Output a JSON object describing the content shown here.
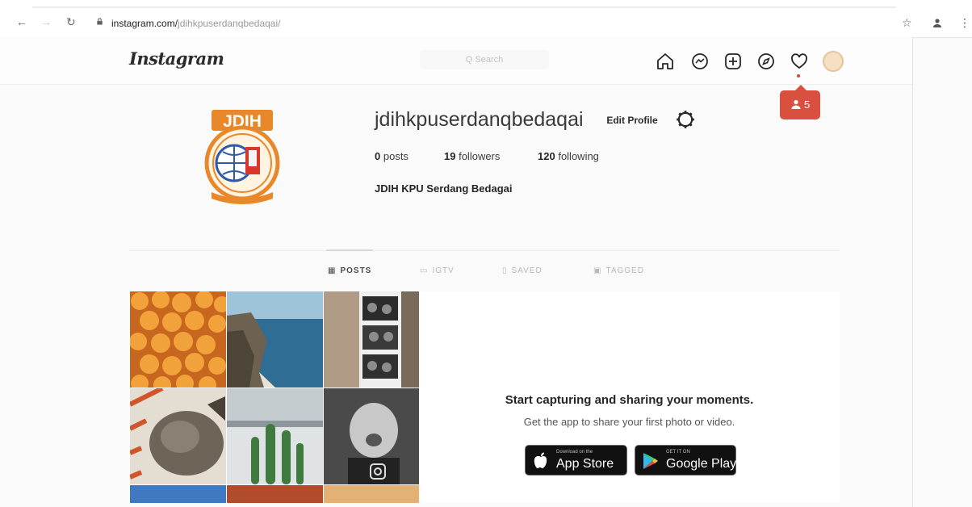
{
  "browser": {
    "url_domain": "instagram.com/",
    "url_path": "jdihkpuserdanqbedaqai/",
    "icons": [
      "back-icon",
      "forward-icon",
      "reload-icon",
      "lock-icon",
      "star-icon",
      "profile-icon",
      "menu-icon"
    ]
  },
  "header": {
    "logo": "Instagram",
    "search_placeholder": "Q Search",
    "icons": [
      "home-icon",
      "messenger-icon",
      "new-post-icon",
      "explore-icon",
      "heart-icon",
      "avatar"
    ]
  },
  "notification": {
    "count": "5"
  },
  "profile": {
    "username": "jdihkpuserdanqbedaqai",
    "edit_label": "Edit Profile",
    "posts_count": "0",
    "posts_label": "posts",
    "followers_count": "19",
    "followers_label": "followers",
    "following_count": "120",
    "following_label": "following",
    "full_name": "JDIH KPU Serdang Bedagai",
    "logo_text": "JDIH"
  },
  "tabs": [
    {
      "label": "POSTS",
      "active": true
    },
    {
      "label": "IGTV",
      "active": false
    },
    {
      "label": "SAVED",
      "active": false
    },
    {
      "label": "TAGGED",
      "active": false
    }
  ],
  "empty_state": {
    "title": "Start capturing and sharing your moments.",
    "subtitle": "Get the app to share your first photo or video.",
    "appstore_small": "Download on the",
    "appstore_big": "App Store",
    "googleplay_small": "GET IT ON",
    "googleplay_big": "Google Play"
  },
  "colors": {
    "badge": "#d9503f",
    "logo_orange": "#e8882a",
    "ig_background": "#fafafa"
  }
}
